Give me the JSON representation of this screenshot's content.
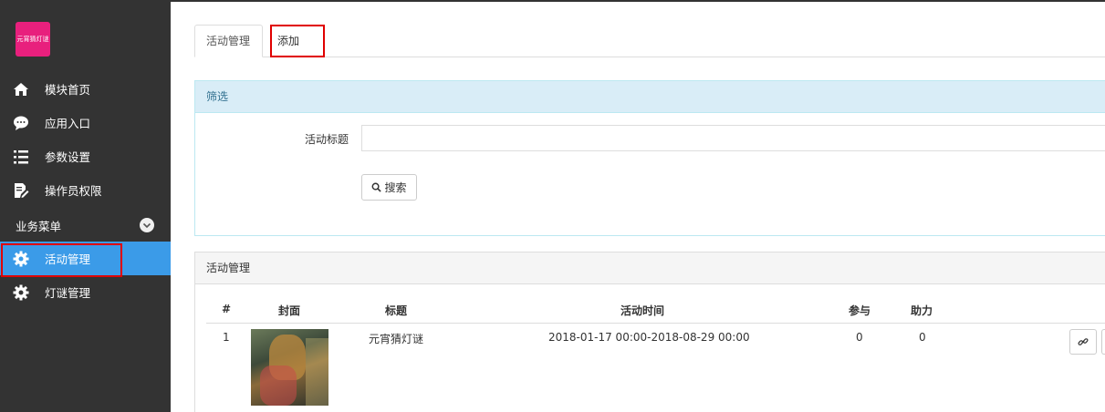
{
  "logo": {
    "text": "元宵猜灯谜",
    "color": "#e8207d"
  },
  "sidebar": {
    "items": [
      {
        "label": "模块首页",
        "icon": "home-icon"
      },
      {
        "label": "应用入口",
        "icon": "chat-icon"
      },
      {
        "label": "参数设置",
        "icon": "list-icon"
      },
      {
        "label": "操作员权限",
        "icon": "edit-doc-icon"
      }
    ],
    "section": {
      "label": "业务菜单",
      "icon": "chevron-down-icon"
    },
    "business": [
      {
        "label": "活动管理",
        "icon": "gear-icon",
        "active": true
      },
      {
        "label": "灯谜管理",
        "icon": "gear-icon",
        "active": false
      }
    ]
  },
  "tabs": [
    {
      "label": "活动管理",
      "active": true
    },
    {
      "label": "添加",
      "active": false
    }
  ],
  "filter": {
    "heading": "筛选",
    "title_label": "活动标题",
    "title_value": "",
    "search_label": "搜索"
  },
  "list": {
    "heading": "活动管理",
    "columns": [
      "#",
      "封面",
      "标题",
      "活动时间",
      "参与",
      "助力"
    ],
    "rows": [
      {
        "index": "1",
        "title": "元宵猜灯谜",
        "time": "2018-01-17 00:00-2018-08-29 00:00",
        "join": "0",
        "help": "0"
      }
    ]
  },
  "colors": {
    "sidebar": "#333333",
    "active": "#3b9be8",
    "highlight": "#e00000",
    "filter_header": "#d9edf7"
  }
}
